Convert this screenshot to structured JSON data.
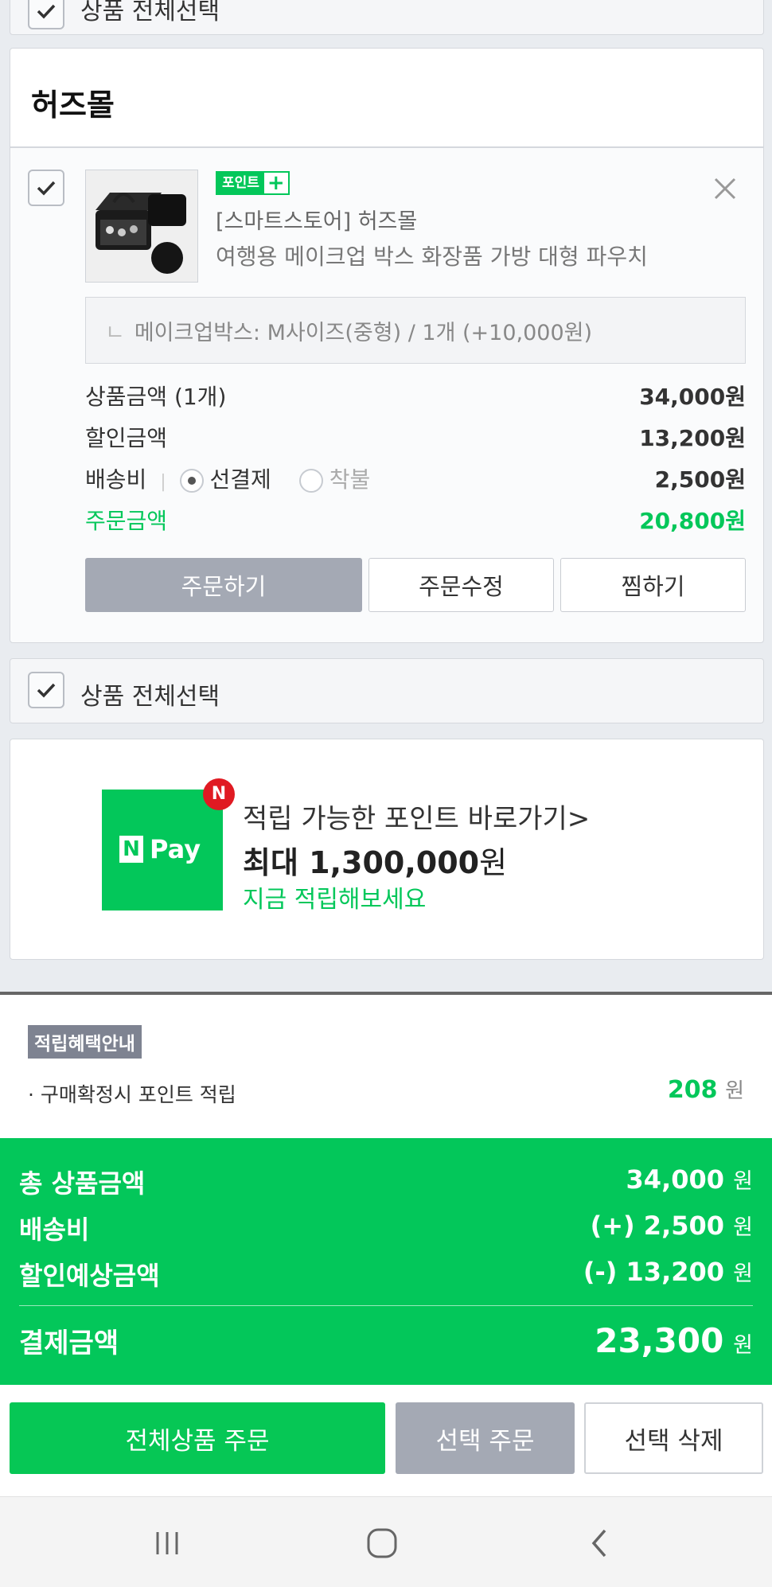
{
  "top_select_all": {
    "label": "상품 전체선택"
  },
  "store": {
    "name": "허즈몰",
    "item": {
      "badge_text": "포인트",
      "badge_plus": "+",
      "store_line": "[스마트스토어] 허즈몰",
      "product_name": "여행용 메이크업 박스 화장품 가방 대형 파우치",
      "option_prefix": "ㄴ",
      "option": "메이크업박스: M사이즈(중형) / 1개 (+10,000원)",
      "price_label": "상품금액 (1개)",
      "price_value": "34,000원",
      "discount_label": "할인금액",
      "discount_value": "13,200원",
      "shipping_label": "배송비",
      "shipping_option_prepaid": "선결제",
      "shipping_option_cod": "착불",
      "shipping_value": "2,500원",
      "order_label": "주문금액",
      "order_value": "20,800원",
      "buttons": {
        "order": "주문하기",
        "edit": "주문수정",
        "wish": "찜하기"
      }
    }
  },
  "bottom_select_all": {
    "label": "상품 전체선택"
  },
  "npay_banner": {
    "logo_n": "N",
    "logo_pay": "Pay",
    "dot": "N",
    "line1": "적립 가능한 포인트 바로가기>",
    "line2_prefix": "최대 ",
    "line2_amount": "1,300,000",
    "line2_suffix": "원",
    "line3": "지금 적립해보세요"
  },
  "reward": {
    "tag": "적립혜택안내",
    "label": "· 구매확정시 포인트 적립",
    "value": "208",
    "unit": "원"
  },
  "summary": {
    "total_label": "총 상품금액",
    "total_value": "34,000",
    "shipping_label": "배송비",
    "shipping_value": "(+) 2,500",
    "discount_label": "할인예상금액",
    "discount_value": "(-) 13,200",
    "pay_label": "결제금액",
    "pay_value": "23,300",
    "unit": "원"
  },
  "actions": {
    "order_all": "전체상품 주문",
    "order_selected": "선택 주문",
    "delete_selected": "선택 삭제"
  },
  "colors": {
    "accent_green": "#03c75a",
    "gray_button": "#a4a9b4"
  }
}
